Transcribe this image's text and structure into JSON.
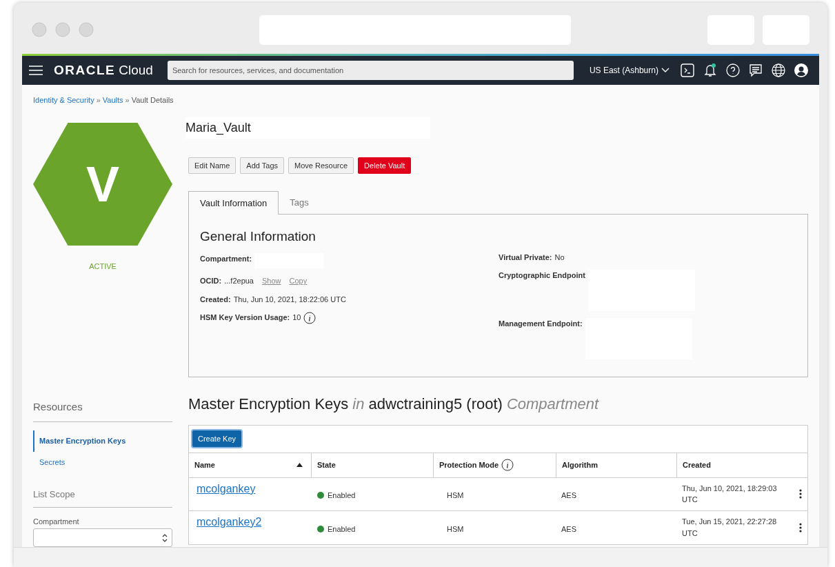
{
  "nav": {
    "logo_word": "ORACLE",
    "logo_product": "Cloud",
    "search": {
      "placeholder": "Search for resources, services, and documentation"
    },
    "region": "US East (Ashburn)",
    "notification_dot": true
  },
  "breadcrumb": [
    {
      "label": "Identity & Security",
      "kind": "link"
    },
    {
      "label": "»",
      "kind": "separator"
    },
    {
      "label": "Vaults",
      "kind": "link"
    },
    {
      "label": "»",
      "kind": "separator"
    },
    {
      "label": "Vault Details",
      "kind": "current"
    }
  ],
  "vault": {
    "letter": "V",
    "status": "ACTIVE",
    "name": "Maria_Vault"
  },
  "actions": [
    {
      "label": "Edit Name",
      "kind": "default"
    },
    {
      "label": "Add Tags",
      "kind": "default"
    },
    {
      "label": "Move Resource",
      "kind": "default"
    },
    {
      "label": "Delete Vault",
      "kind": "danger"
    }
  ],
  "tabs": [
    {
      "label": "Vault Information",
      "selected": true
    },
    {
      "label": "Tags",
      "selected": false
    }
  ],
  "general": {
    "title": "General Information",
    "left": [
      {
        "label": "Compartment:",
        "redacted": true
      },
      {
        "label": "OCID:",
        "value": "...f2epua",
        "links": [
          "Show",
          "Copy"
        ]
      },
      {
        "label": "Created:",
        "value": "Thu, Jun 10, 2021, 18:22:06 UTC"
      },
      {
        "label": "HSM Key Version Usage:",
        "value": "10",
        "info": true
      }
    ],
    "right": [
      {
        "label": "Virtual Private:",
        "value": "No"
      },
      {
        "label": "Cryptographic Endpoint",
        "redacted": true
      },
      {
        "label": "Management Endpoint:",
        "redacted": true
      }
    ]
  },
  "resources": {
    "title": "Resources",
    "items": [
      {
        "label": "Master Encryption Keys",
        "selected": true
      },
      {
        "label": "Secrets",
        "selected": false
      }
    ]
  },
  "list_scope": {
    "title": "List Scope",
    "compartment_label": "Compartment"
  },
  "keys": {
    "title_parts": [
      {
        "text": "Master Encryption Keys",
        "italic": false
      },
      {
        "text": "in",
        "italic": true
      },
      {
        "text": "adwctraining5 (root)",
        "italic": false
      },
      {
        "text": "Compartment",
        "italic": true
      }
    ],
    "create_button": "Create Key",
    "columns": [
      {
        "label": "Name",
        "sorted": true,
        "info": false
      },
      {
        "label": "State",
        "sorted": false,
        "info": false
      },
      {
        "label": "Protection Mode",
        "sorted": false,
        "info": true
      },
      {
        "label": "Algorithm",
        "sorted": false,
        "info": false
      },
      {
        "label": "Created",
        "sorted": false,
        "info": false
      }
    ],
    "rows": [
      {
        "name": "mcolgankey",
        "state": "Enabled",
        "color": "#2e8b3a",
        "protection": "HSM",
        "algorithm": "AES",
        "created": "Thu, Jun 10, 2021, 18:29:03 UTC"
      },
      {
        "name": "mcolgankey2",
        "state": "Enabled",
        "color": "#2e8b3a",
        "protection": "HSM",
        "algorithm": "AES",
        "created": "Tue, Jun 15, 2021, 22:27:28 UTC"
      }
    ]
  }
}
